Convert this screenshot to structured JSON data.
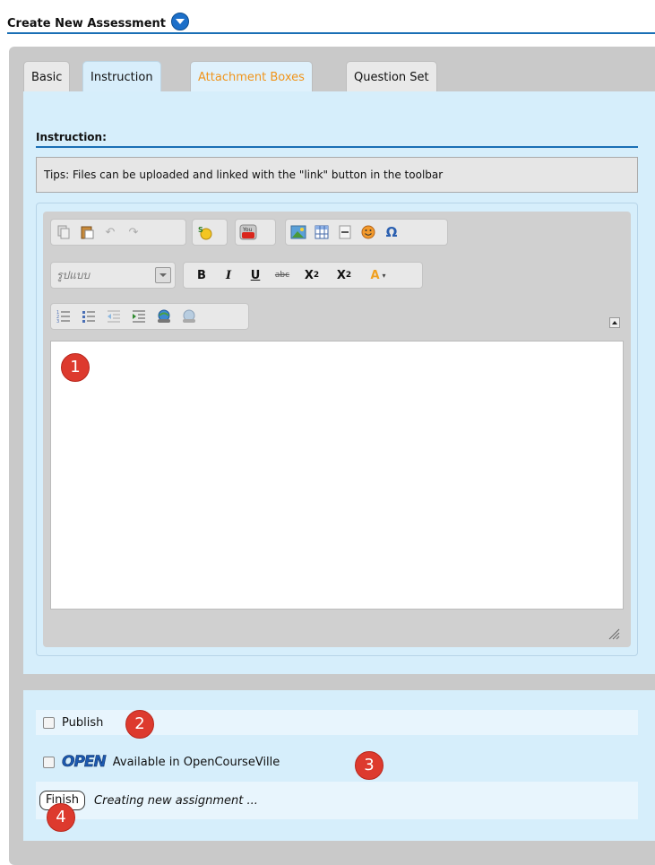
{
  "header": {
    "title": "Create New Assessment"
  },
  "tabs": [
    {
      "label": "Basic"
    },
    {
      "label": "Instruction"
    },
    {
      "label": "Attachment Boxes"
    },
    {
      "label": "Question Set"
    }
  ],
  "instruction": {
    "label": "Instruction:",
    "tips": "Tips: Files can be uploaded and linked with the \"link\" button in the toolbar"
  },
  "editor": {
    "format_select": "รูปแบบ",
    "toolbar_row1": [
      "copy-icon",
      "paste-icon",
      "undo-icon",
      "redo-icon",
      "spellcheck-icon",
      "youtube-icon",
      "image-icon",
      "table-icon",
      "horizontal-rule-icon",
      "smiley-icon",
      "special-char-icon"
    ],
    "bold": "B",
    "italic": "I",
    "underline": "U",
    "strike": "abc",
    "subscript": "X",
    "sub_mark": "2",
    "superscript": "X",
    "sup_mark": "2",
    "font_color": "A",
    "omega": "Ω"
  },
  "markers": [
    "1",
    "2",
    "3",
    "4"
  ],
  "options": {
    "publish_label": "Publish",
    "open_logo": "OPEN",
    "available_label": "Available in OpenCourseVille",
    "finish_button": "Finish",
    "status_text": "Creating new assignment ..."
  },
  "colors": {
    "accent": "#1a6fb5",
    "panel": "#d6eefb",
    "orange_tab": "#f0941a",
    "marker": "#dd3a2e"
  }
}
